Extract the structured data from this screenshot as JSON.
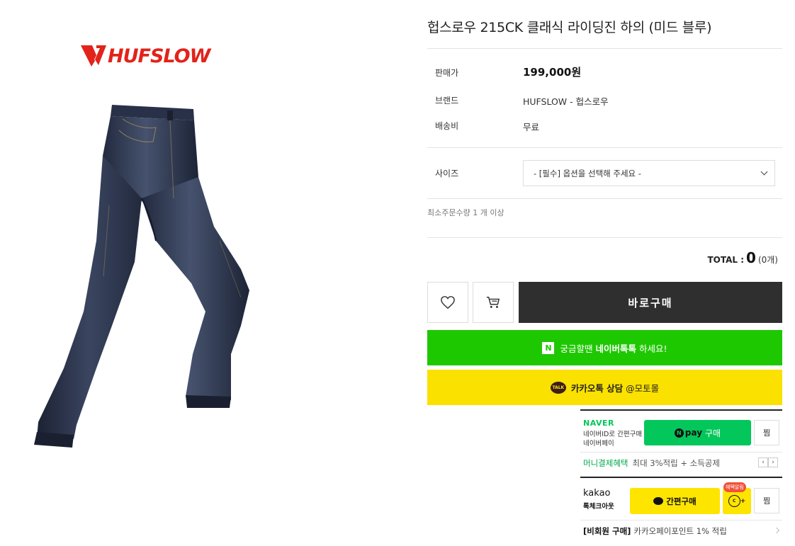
{
  "brand_logo": {
    "text": "HUFSLOW",
    "color": "#e2231a"
  },
  "product": {
    "title": "헙스로우 215CK 클래식 라이딩진 하의 (미드 블루)",
    "price_label": "판매가",
    "price": "199,000원",
    "brand_label": "브랜드",
    "brand": "HUFSLOW - 헙스로우",
    "shipping_label": "배송비",
    "shipping": "무료"
  },
  "options": {
    "size_label": "사이즈",
    "size_select": "- [필수] 옵션을 선택해 주세요 -",
    "min_order": "최소주문수량 1 개 이상"
  },
  "total": {
    "label": "TOTAL :",
    "value": "0",
    "count": "(0개)"
  },
  "actions": {
    "wishlist_icon": "heart-icon",
    "cart_icon": "cart-icon",
    "buy_now": "바로구매",
    "naver_talk_badge": "N",
    "naver_talk_prefix": "궁금할땐",
    "naver_talk_bold": "네이버톡톡",
    "naver_talk_suffix": "하세요!",
    "kakao_talk_badge": "TALK",
    "kakao_talk_bold": "카카오톡 상담",
    "kakao_talk_suffix": "@모토몰"
  },
  "naver_pay": {
    "logo": "NAVER",
    "sub1": "네이버ID로 간편구매",
    "sub2": "네이버페이",
    "button_n": "N",
    "button_pay": "pay",
    "button_buy": "구매",
    "jjim": "찜",
    "benefit_green": "머니결제혜택",
    "benefit_desc": "최대 3%적립 + 소득공제",
    "prev": "‹",
    "next": "›"
  },
  "kakao_pay": {
    "logo": "kakao",
    "sub": "톡체크아웃",
    "button": "간편구매",
    "badge": "혜택알림",
    "coin": "C",
    "coin_plus": "+",
    "jjim": "찜",
    "nonmember_bold": "[비회원 구매]",
    "nonmember_desc": "카카오페이포인트 1% 적립"
  },
  "colors": {
    "naver_green": "#1ec800",
    "kakao_yellow": "#fae100",
    "buy_dark": "#2f2f2f"
  }
}
